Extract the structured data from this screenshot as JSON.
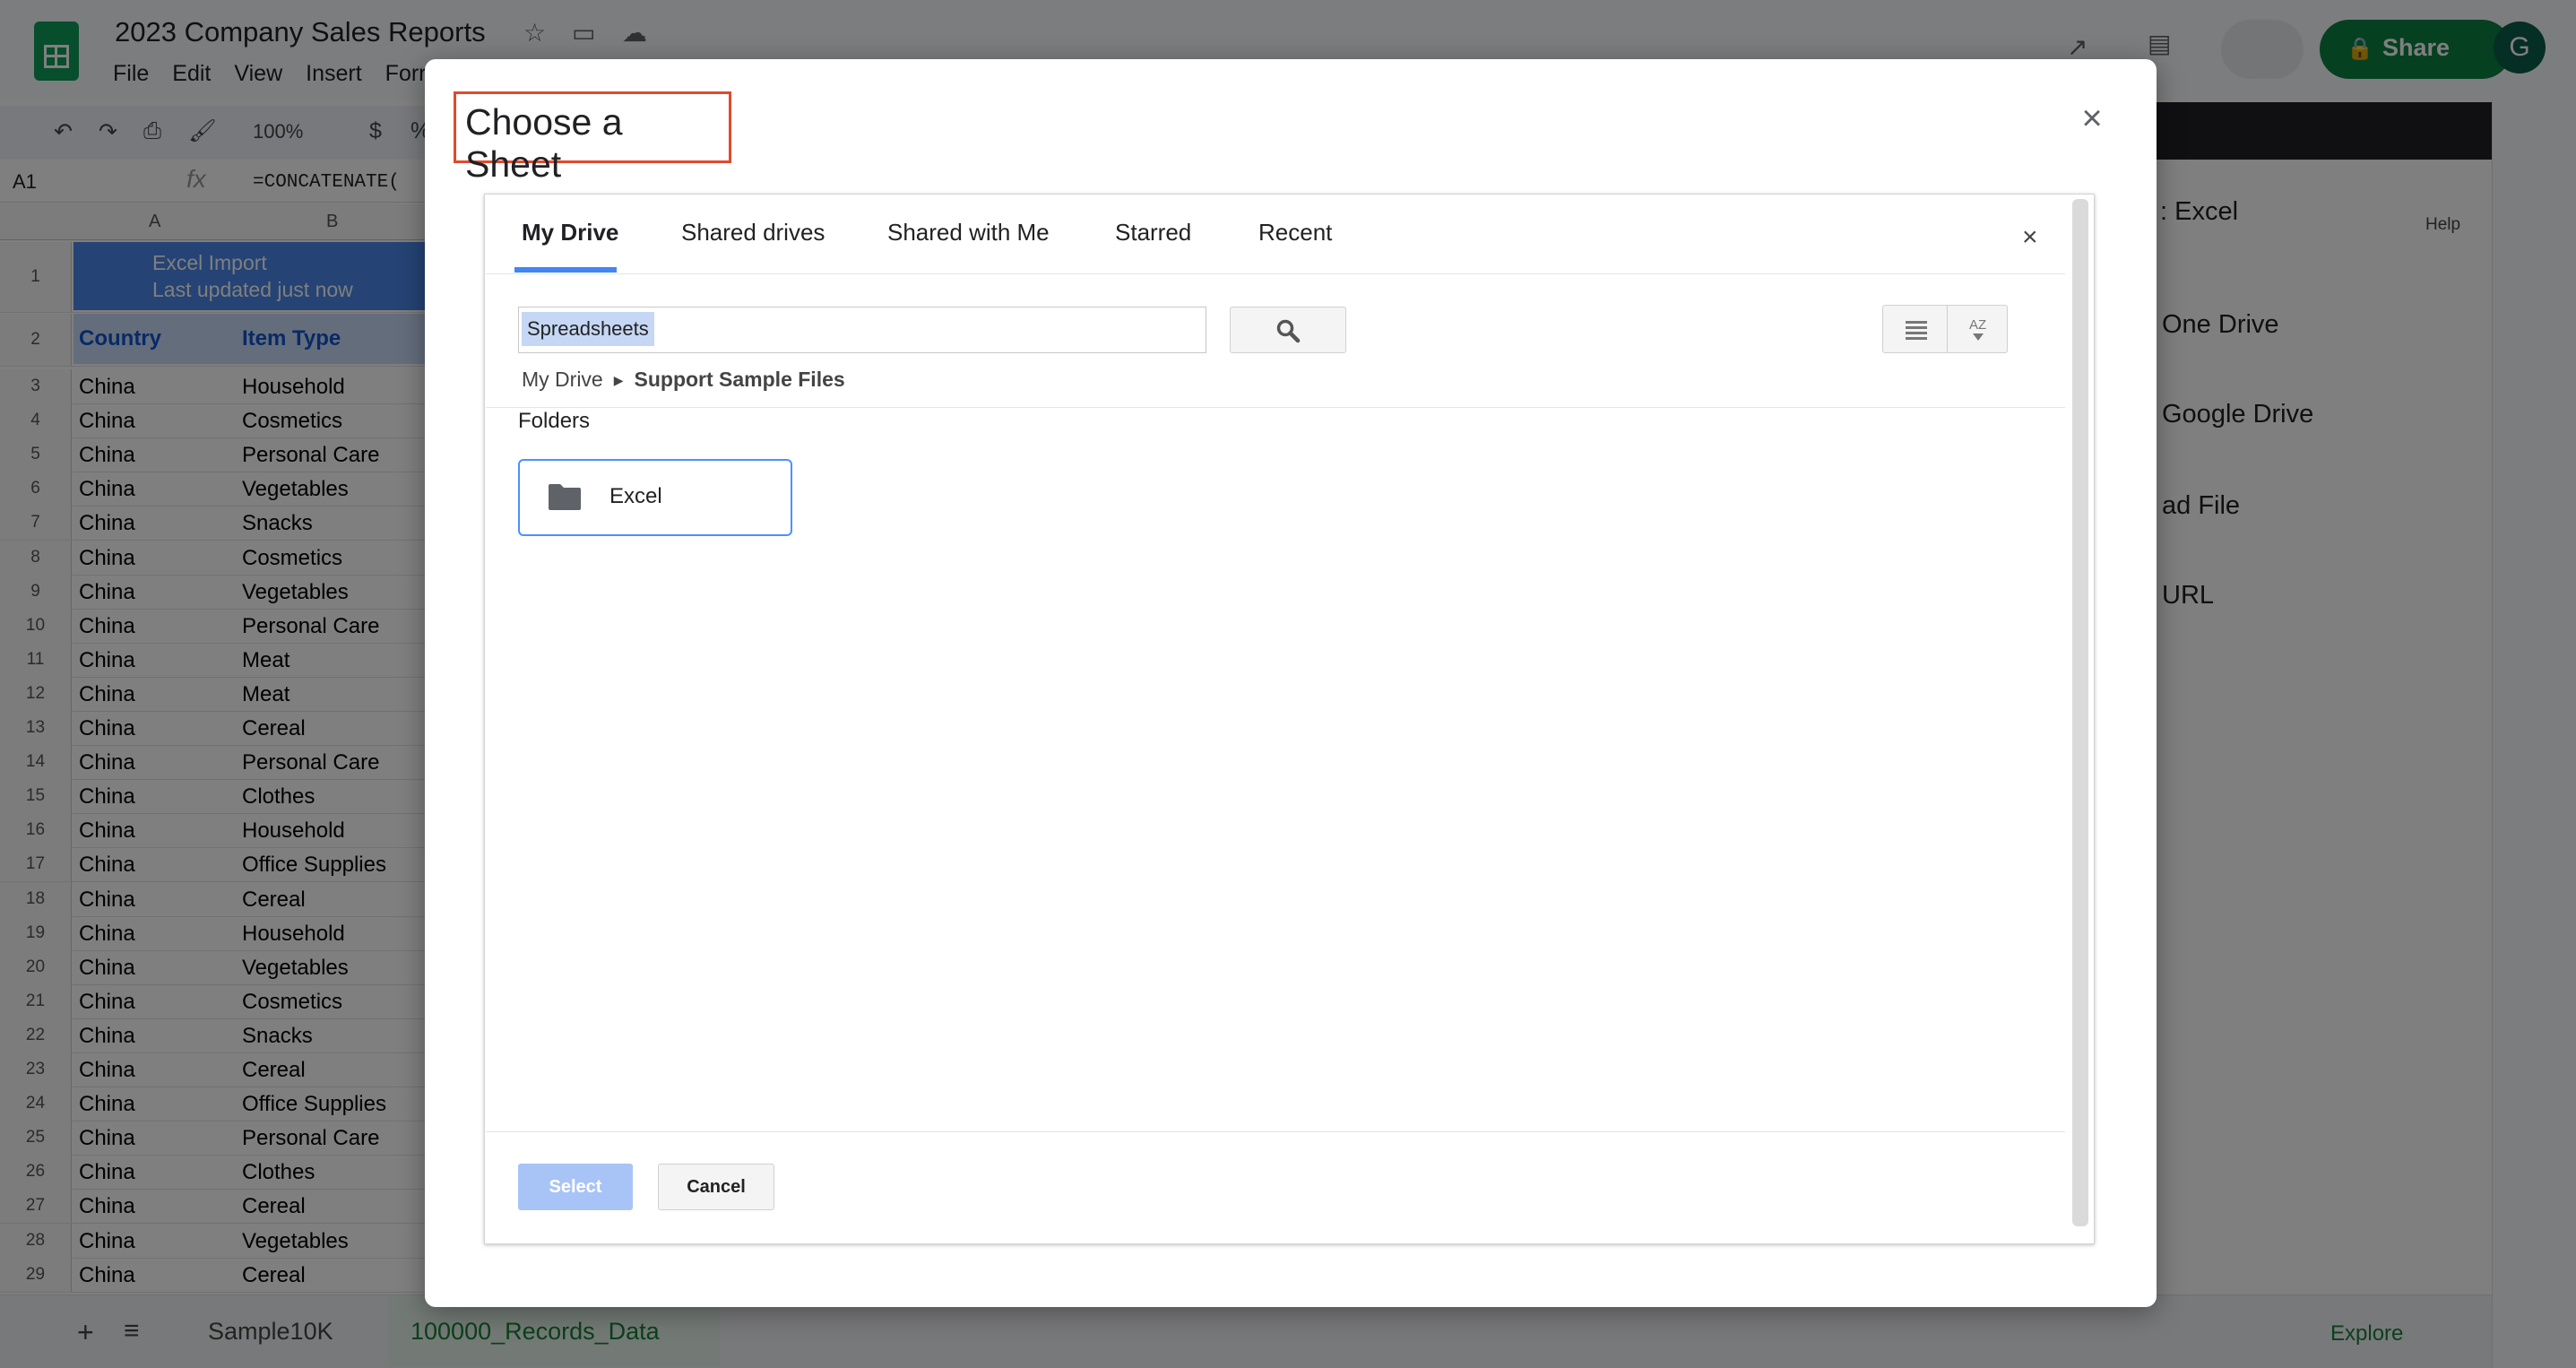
{
  "sheets": {
    "doc_title": "2023 Company Sales Reports",
    "menu": [
      "File",
      "Edit",
      "View",
      "Insert",
      "Forr"
    ],
    "zoom": "100%",
    "currency_symbol": "$",
    "percent_symbol": "%",
    "name_box": "A1",
    "formula": "=CONCATENATE(",
    "columns": [
      "A",
      "B"
    ],
    "row1": {
      "line1": "Excel Import",
      "line2": "Last updated just now"
    },
    "header_row": {
      "country": "Country",
      "item_type": "Item Type"
    },
    "rows": [
      {
        "num": "1"
      },
      {
        "num": "2"
      },
      {
        "num": "3",
        "a": "China",
        "b": "Household"
      },
      {
        "num": "4",
        "a": "China",
        "b": "Cosmetics"
      },
      {
        "num": "5",
        "a": "China",
        "b": "Personal Care"
      },
      {
        "num": "6",
        "a": "China",
        "b": "Vegetables"
      },
      {
        "num": "7",
        "a": "China",
        "b": "Snacks"
      },
      {
        "num": "8",
        "a": "China",
        "b": "Cosmetics"
      },
      {
        "num": "9",
        "a": "China",
        "b": "Vegetables"
      },
      {
        "num": "10",
        "a": "China",
        "b": "Personal Care"
      },
      {
        "num": "11",
        "a": "China",
        "b": "Meat"
      },
      {
        "num": "12",
        "a": "China",
        "b": "Meat"
      },
      {
        "num": "13",
        "a": "China",
        "b": "Cereal"
      },
      {
        "num": "14",
        "a": "China",
        "b": "Personal Care"
      },
      {
        "num": "15",
        "a": "China",
        "b": "Clothes"
      },
      {
        "num": "16",
        "a": "China",
        "b": "Household"
      },
      {
        "num": "17",
        "a": "China",
        "b": "Office Supplies"
      },
      {
        "num": "18",
        "a": "China",
        "b": "Cereal"
      },
      {
        "num": "19",
        "a": "China",
        "b": "Household"
      },
      {
        "num": "20",
        "a": "China",
        "b": "Vegetables"
      },
      {
        "num": "21",
        "a": "China",
        "b": "Cosmetics"
      },
      {
        "num": "22",
        "a": "China",
        "b": "Snacks"
      },
      {
        "num": "23",
        "a": "China",
        "b": "Cereal"
      },
      {
        "num": "24",
        "a": "China",
        "b": "Office Supplies"
      },
      {
        "num": "25",
        "a": "China",
        "b": "Personal Care"
      },
      {
        "num": "26",
        "a": "China",
        "b": "Clothes"
      },
      {
        "num": "27",
        "a": "China",
        "b": "Cereal"
      },
      {
        "num": "28",
        "a": "China",
        "b": "Vegetables"
      },
      {
        "num": "29",
        "a": "China",
        "b": "Cereal"
      }
    ],
    "sheet_tabs": [
      "Sample10K",
      "100000_Records_Data"
    ],
    "explore_label": "Explore",
    "share_label": "Share",
    "avatar_letter": "G",
    "right_panel": {
      "title_fragment": ": Excel",
      "help_label": "Help",
      "items": [
        "One Drive",
        "Google Drive",
        "ad File",
        "URL"
      ]
    }
  },
  "dialog": {
    "title": "Choose a Sheet",
    "close_icon": "close-icon"
  },
  "picker": {
    "tabs": [
      "My Drive",
      "Shared drives",
      "Shared with Me",
      "Starred",
      "Recent"
    ],
    "active_tab": "My Drive",
    "search_token": "Spreadsheets",
    "search_icon": "search-icon",
    "breadcrumb": {
      "root": "My Drive",
      "current": "Support Sample Files"
    },
    "folders_heading": "Folders",
    "folders": [
      {
        "name": "Excel",
        "icon": "folder-icon"
      }
    ],
    "select_label": "Select",
    "cancel_label": "Cancel",
    "close_symbol": "×"
  },
  "colors": {
    "accent_blue": "#4285f4",
    "title_highlight": "#e04a2d",
    "select_disabled": "#a8c4f6",
    "share_green": "#0b8043"
  }
}
